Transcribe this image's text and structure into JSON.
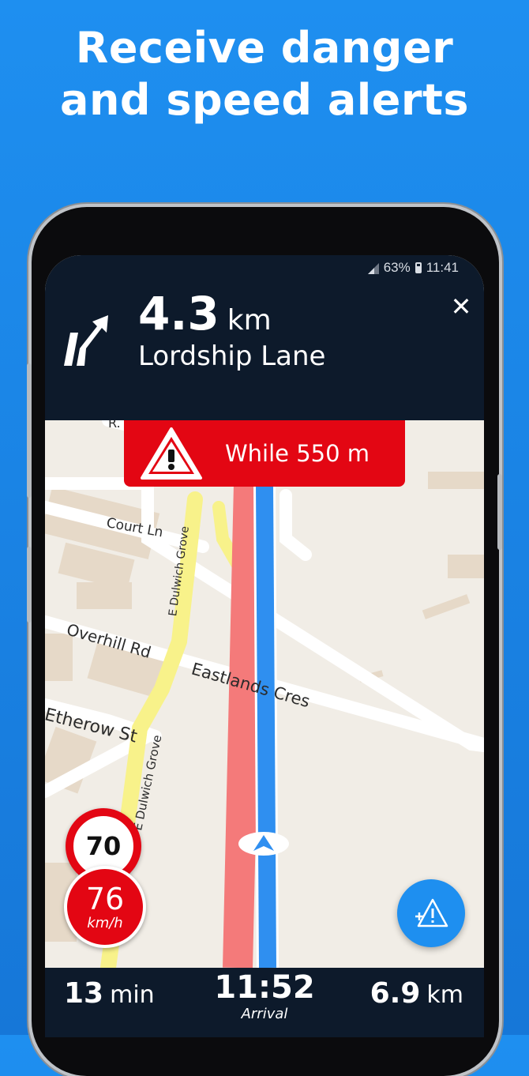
{
  "headline": {
    "line1": "Receive danger",
    "line2": "and speed alerts"
  },
  "status_bar": {
    "battery": "63%",
    "time": "11:41"
  },
  "navigation": {
    "distance_value": "4.3",
    "distance_unit": "km",
    "street": "Lordship Lane",
    "close_label": "✕",
    "turn_icon": "keep-right-arrow-icon"
  },
  "alert": {
    "text": "While 550 m",
    "icon": "warning-triangle-icon"
  },
  "map": {
    "labels": {
      "court": "Court Ln",
      "dulwich_top": "E Dulwich Grove",
      "overhill": "Overhill Rd",
      "eastlands": "Eastlands Cres",
      "etherow": "Etherow St",
      "dulwich_bottom": "E Dulwich Grove",
      "partial_top": "R. G"
    }
  },
  "speed": {
    "limit": "70",
    "current": "76",
    "unit": "km/h"
  },
  "report_button": {
    "icon": "add-hazard-icon"
  },
  "trip": {
    "remaining_time_value": "13",
    "remaining_time_unit": "min",
    "arrival_time": "11:52",
    "arrival_label": "Arrival",
    "remaining_distance_value": "6.9",
    "remaining_distance_unit": "km"
  },
  "colors": {
    "background": "#1e8ff0",
    "nav_panel": "#0d1a2b",
    "alert_red": "#e30613",
    "route_blue": "#2f8ff0",
    "traffic_red": "#f47a7a",
    "major_road_yellow": "#f8f28a"
  }
}
